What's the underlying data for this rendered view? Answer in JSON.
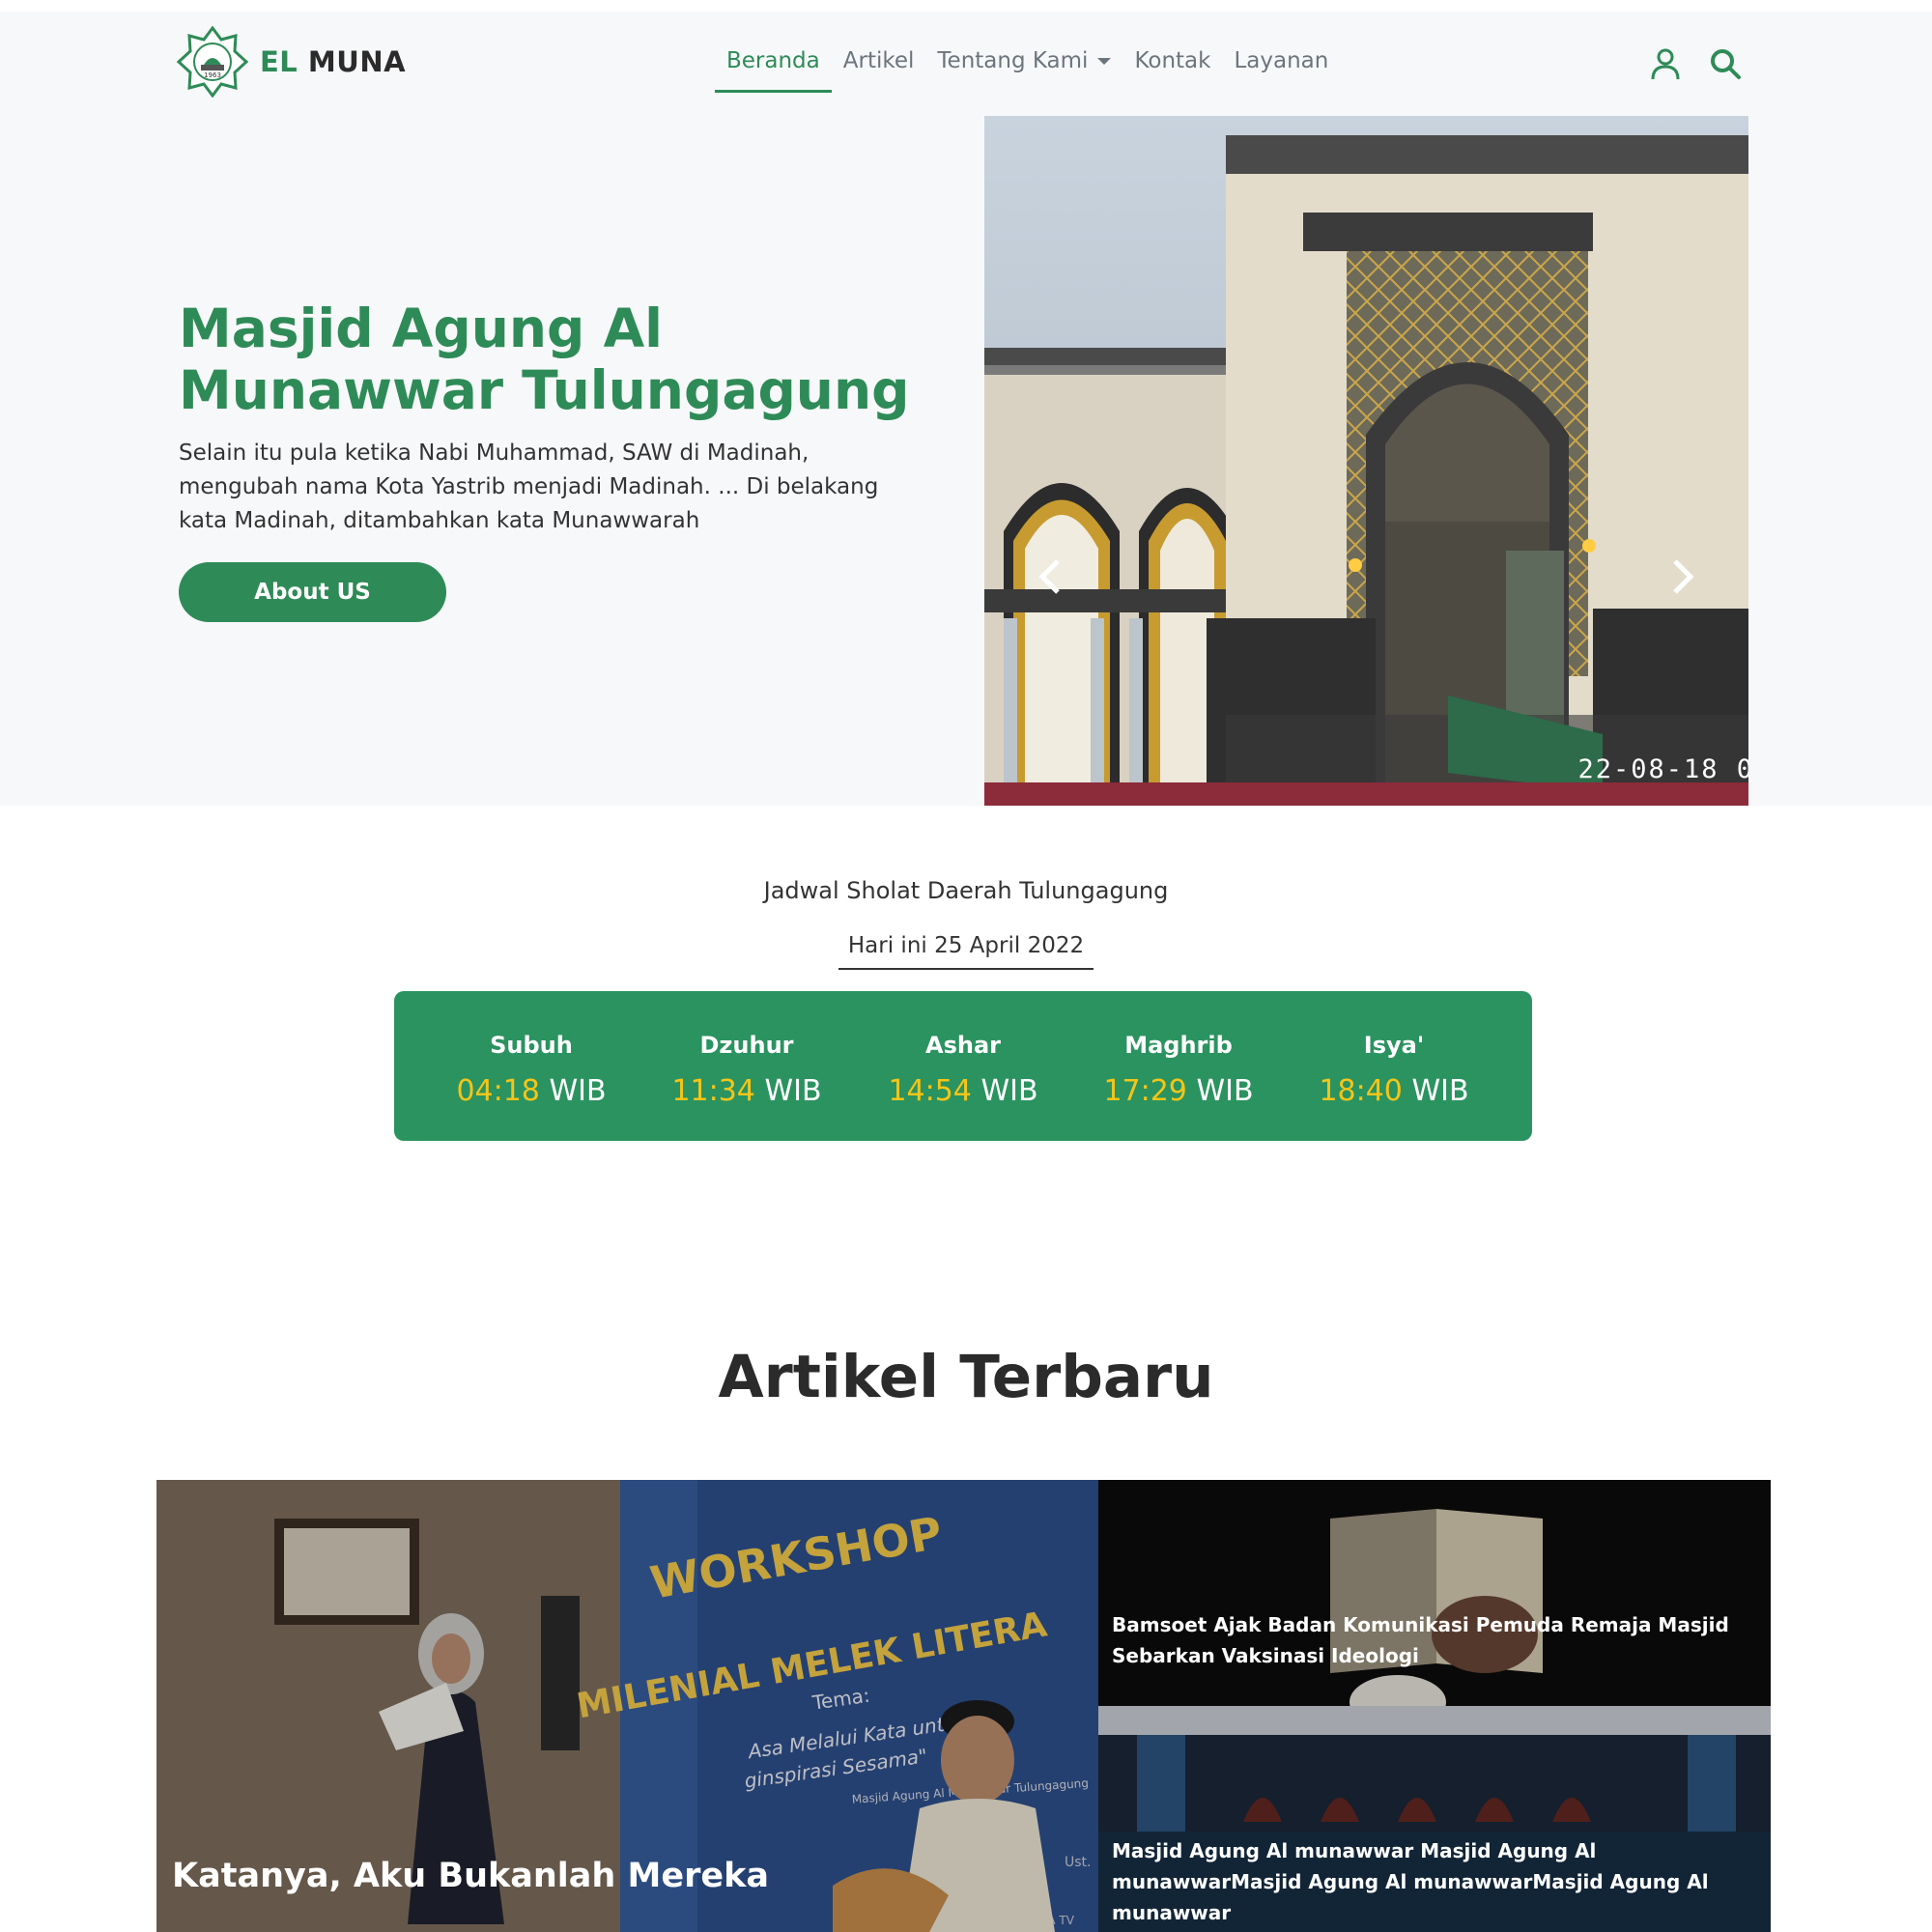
{
  "brand": {
    "logo_text": "1963",
    "name_part1": "EL",
    "name_part2": "MUNA"
  },
  "nav": {
    "items": [
      {
        "label": "Beranda",
        "active": true
      },
      {
        "label": "Artikel",
        "active": false
      },
      {
        "label": "Tentang Kami",
        "active": false,
        "dropdown": true
      },
      {
        "label": "Kontak",
        "active": false
      },
      {
        "label": "Layanan",
        "active": false
      }
    ],
    "icons": [
      "user-icon",
      "search-icon"
    ]
  },
  "hero": {
    "title": "Masjid Agung Al Munawwar Tulungagung",
    "description": "Selain itu pula ketika Nabi Muhammad, SAW di Madinah, mengubah nama Kota Yastrib menjadi Madinah. ... Di belakang kata Madinah, ditambahkan kata Munawwarah",
    "button_label": "About US",
    "image_timestamp": "22-08-18 0"
  },
  "prayer": {
    "caption": "Jadwal Sholat Daerah Tulungagung",
    "date": "Hari ini 25 April 2022",
    "times": [
      {
        "name": "Subuh",
        "time": "04:18",
        "zone": "WIB"
      },
      {
        "name": "Dzuhur",
        "time": "11:34",
        "zone": "WIB"
      },
      {
        "name": "Ashar",
        "time": "14:54",
        "zone": "WIB"
      },
      {
        "name": "Maghrib",
        "time": "17:29",
        "zone": "WIB"
      },
      {
        "name": "Isya'",
        "time": "18:40",
        "zone": "WIB"
      }
    ]
  },
  "articles": {
    "section_title": "Artikel Terbaru",
    "items": [
      {
        "title": "Katanya, Aku Bukanlah Mereka",
        "banner_line1": "WORKSHOP",
        "banner_line2": "MILENIAL MELEK LITERA",
        "banner_tema": "Tema:",
        "banner_sub1": "Asa Melalui Kata untuk",
        "banner_sub2": "ginspirasi Sesama\"",
        "banner_org": "Masjid Agung Al Munawwar Tulungagung",
        "banner_ust": "Ust.",
        "banner_tv": "ELMUNA TV"
      },
      {
        "title": "Bamsoet Ajak Badan Komunikasi Pemuda Remaja Masjid Sebarkan Vaksinasi Ideologi"
      },
      {
        "title": "Masjid Agung Al munawwar Masjid Agung Al munawwarMasjid Agung Al munawwarMasjid Agung Al munawwar"
      }
    ]
  },
  "colors": {
    "primary": "#2e8b57",
    "prayer_box": "#2b9360",
    "time_accent": "#f5c518",
    "hero_bg": "#f7f8fa"
  }
}
